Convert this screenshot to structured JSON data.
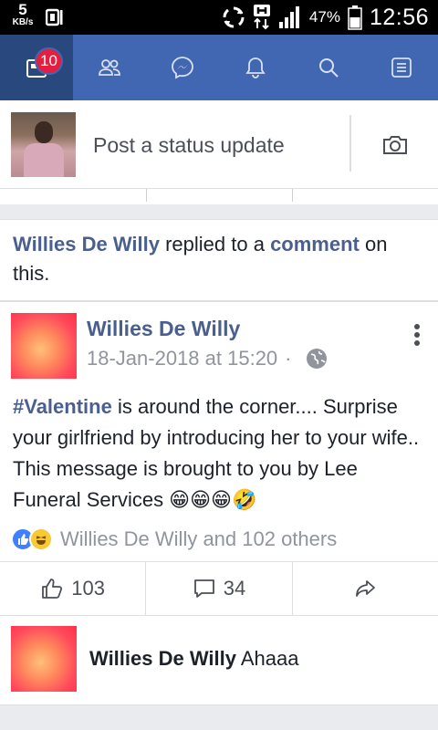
{
  "status_bar": {
    "net_speed": "5",
    "net_unit": "KB/s",
    "battery_pct": "47%",
    "time": "12:56"
  },
  "nav": {
    "notification_count": "10",
    "icons": [
      "news-feed-icon",
      "friends-icon",
      "messenger-icon",
      "notifications-icon",
      "search-icon",
      "menu-icon"
    ]
  },
  "composer": {
    "placeholder": "Post a status update"
  },
  "story": {
    "actor": "Willies De Willy",
    "verb": " replied to a ",
    "object": "comment",
    "suffix": " on this."
  },
  "post": {
    "author": "Willies De Willy",
    "timestamp": "18-Jan-2018 at 15:20",
    "dot": "·",
    "hashtag": "#Valentine",
    "text": " is around the corner.... Surprise your girlfriend by introducing her to your wife.. This message is brought to you by Lee Funeral Services 😁😁😁🤣",
    "reactions_text": "Willies De Willy and 102 others",
    "like_count": "103",
    "comment_count": "34"
  },
  "comment": {
    "author": "Willies De Willy",
    "text": " Ahaaa"
  },
  "colors": {
    "nav_bg": "#4267b2",
    "nav_active": "#29487d",
    "badge": "#e41e3f",
    "link": "#4b5f8f"
  }
}
